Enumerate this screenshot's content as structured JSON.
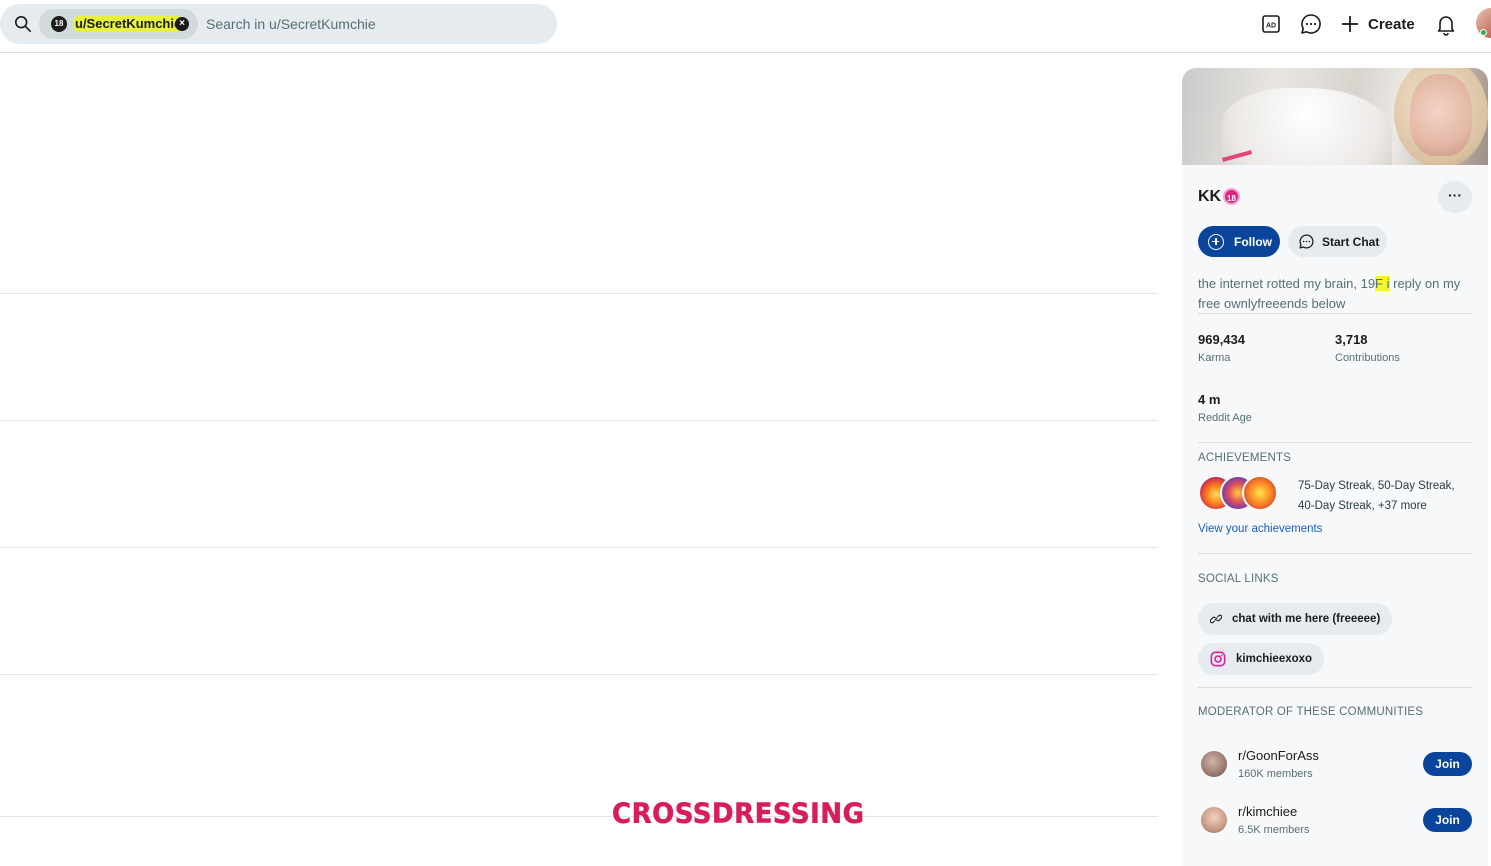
{
  "header": {
    "search_chip_badge": "18",
    "search_chip_label": "u/SecretKumchie",
    "search_placeholder": "Search in u/SecretKumchie",
    "create_label": "Create"
  },
  "feed": {
    "overlay_text": "CROSSDRESSING"
  },
  "profile": {
    "display_name": "KK",
    "nsfw_badge": "18",
    "more_label": "···",
    "follow_label": "Follow",
    "start_chat_label": "Start Chat",
    "bio_part1": "the internet rotted my brain, 19",
    "bio_highlight": "F i",
    "bio_part2": " reply on my free ownlyfreeends below",
    "stats": {
      "karma_value": "969,434",
      "karma_label": "Karma",
      "contributions_value": "3,718",
      "contributions_label": "Contributions",
      "age_value": "4 m",
      "age_label": "Reddit Age"
    },
    "achievements": {
      "title": "ACHIEVEMENTS",
      "summary": "75-Day Streak, 50-Day Streak, 40-Day Streak, +37 more",
      "link": "View your achievements"
    },
    "social_links": {
      "title": "SOCIAL LINKS",
      "items": [
        {
          "label": "chat with me here (freeeee)",
          "icon": "link-icon"
        },
        {
          "label": "kimchieexoxo",
          "icon": "instagram-icon"
        }
      ]
    },
    "moderator": {
      "title": "MODERATOR OF THESE COMMUNITIES",
      "communities": [
        {
          "name": "r/GoonForAss",
          "members": "160K members",
          "join_label": "Join"
        },
        {
          "name": "r/kimchiee",
          "members": "6.5K members",
          "join_label": "Join"
        }
      ]
    }
  },
  "colors": {
    "accent": "#0a449b",
    "nsfw": "#d9287f",
    "highlight": "#f5f52d",
    "overlay": "#d81d5d"
  }
}
